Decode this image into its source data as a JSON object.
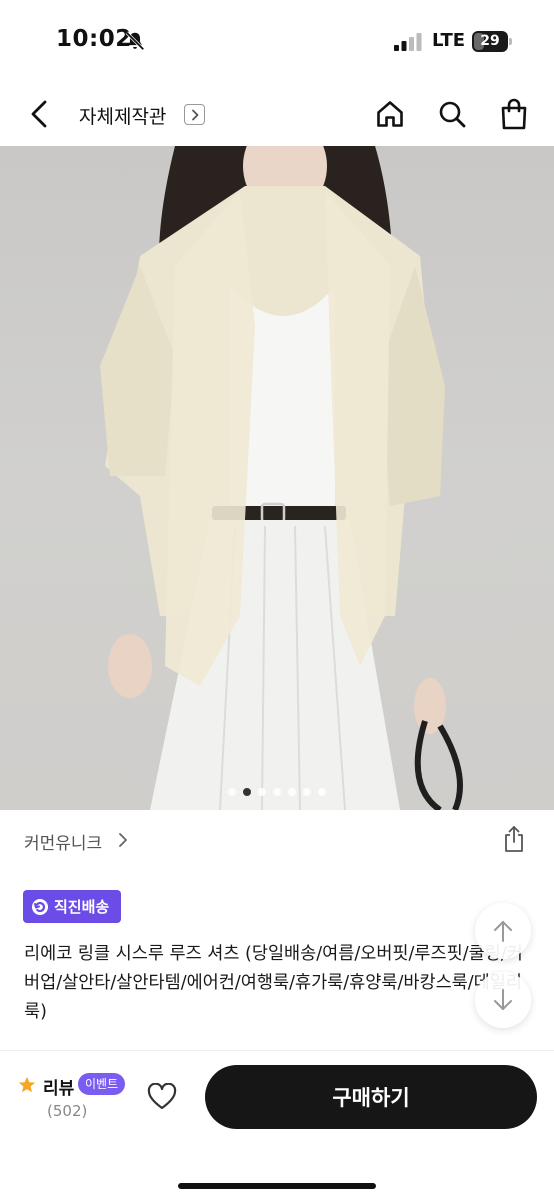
{
  "status_bar": {
    "time": "10:02",
    "network": "LTE",
    "battery_level": "29",
    "icons": [
      "bell-slash-icon",
      "signal-icon",
      "battery-icon"
    ]
  },
  "header": {
    "title": "자체제작관",
    "icons": [
      "back-arrow-icon",
      "chevron-right-icon",
      "home-icon",
      "search-icon",
      "shopping-bag-icon"
    ]
  },
  "gallery": {
    "total_slides": 7,
    "active_slide": 2
  },
  "brand": {
    "name": "커먼유니크",
    "icons": [
      "chevron-right-icon",
      "share-icon"
    ]
  },
  "delivery_badge": {
    "label": "직진배송",
    "color": "#6b4ce6",
    "icon": "refresh-arrow-icon"
  },
  "product": {
    "title": "리에코 링클 시스루 루즈 셔츠 (당일배송/여름/오버핏/루즈핏/쿨링/커버업/살안타/살안타템/에어컨/여행룩/휴가룩/휴양룩/바캉스룩/데일리룩)"
  },
  "floating_buttons": {
    "icons": [
      "arrow-up-icon",
      "arrow-down-icon"
    ]
  },
  "bottom_bar": {
    "review_label": "리뷰",
    "review_badge": "이벤트",
    "review_count": "(502)",
    "buy_label": "구매하기",
    "accent_star": "#f5a623",
    "badge_color": "#7a5cf0",
    "buy_color": "#161616",
    "icons": [
      "star-icon",
      "heart-icon"
    ]
  }
}
